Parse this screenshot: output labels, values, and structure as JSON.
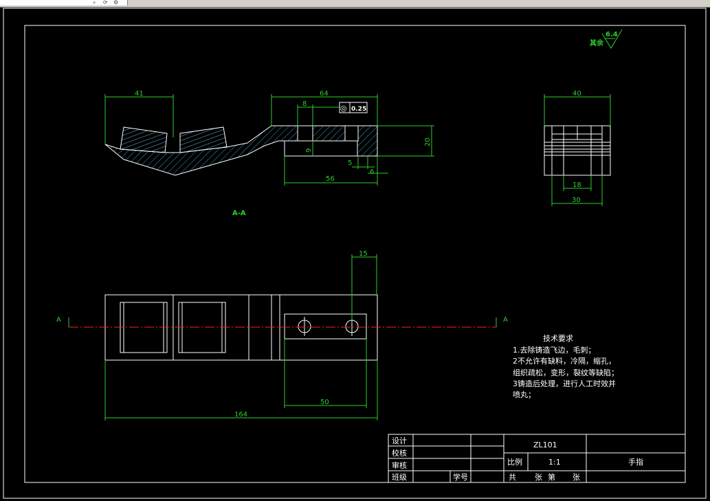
{
  "colors": {
    "background": "#000000",
    "line": "#ffffff",
    "dimension": "#2bd12b",
    "centerline": "#ff2020",
    "hatch": "#3aa0c0",
    "drawing": "#6ec0e0"
  },
  "toolbar": {
    "icon1": "search-icon",
    "icon2": "refresh-icon"
  },
  "surface_finish": {
    "note": "其余",
    "value": "6.4"
  },
  "dims": {
    "d41": "41",
    "d64": "64",
    "d8": "8",
    "d20": "20",
    "d9": "9",
    "d5": "5",
    "d6": "6",
    "d56": "56",
    "d40": "40",
    "d18": "18",
    "d30": "30",
    "d15": "15",
    "d50": "50",
    "d164": "164"
  },
  "tolerance": {
    "symbol": "◎",
    "value": "0.25"
  },
  "section": {
    "label": "A-A",
    "marker": "A"
  },
  "requirements": {
    "title": "技术要求",
    "lines": [
      "1.去除铸造飞边，毛刺；",
      "2不允许有缺料，冷隔，缩孔，",
      "组织疏松，变形，裂纹等缺陷；",
      "3铸造后处理，进行人工时效并",
      "喷丸；"
    ]
  },
  "title_block": {
    "design": "设计",
    "check": "校核",
    "review": "审核",
    "class": "班级",
    "student_no": "学号",
    "material": "ZL101",
    "scale_label": "比例",
    "scale": "1:1",
    "part_name": "手指",
    "sheets": [
      "共",
      "张",
      "第",
      "张"
    ]
  }
}
